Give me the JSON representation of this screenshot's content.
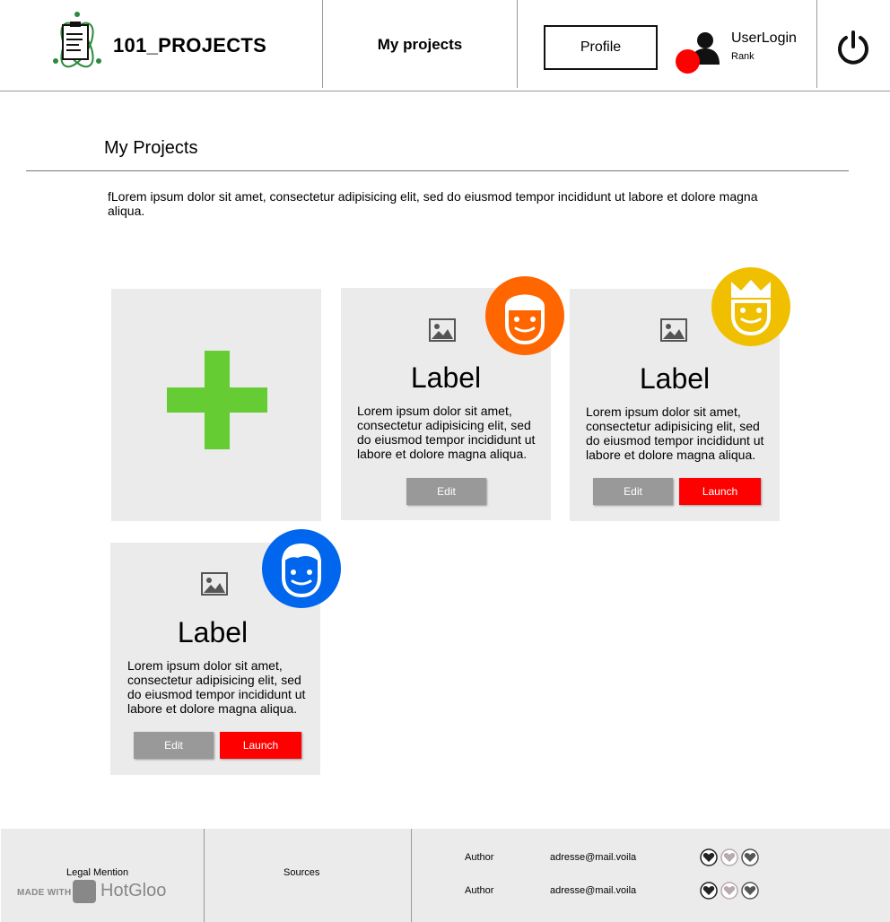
{
  "header": {
    "logo_text": "101_PROJECTS",
    "nav_my_projects": "My projects",
    "profile_button": "Profile",
    "user_login": "UserLogin",
    "user_rank": "Rank"
  },
  "section": {
    "title": "My Projects",
    "intro": "fLorem ipsum dolor sit amet, consectetur adipisicing elit, sed do eiusmod tempor incididunt ut labore et dolore magna aliqua."
  },
  "cards": [
    {
      "label": "Label",
      "description": "Lorem ipsum dolor sit amet, consectetur adipisicing elit, sed do eiusmod tempor incididunt ut labore et dolore magna aliqua.",
      "edit_label": "Edit",
      "badge_color": "#ff6600"
    },
    {
      "label": "Label",
      "description": "Lorem ipsum dolor sit amet, consectetur adipisicing elit, sed do eiusmod tempor incididunt ut labore et dolore magna aliqua.",
      "edit_label": "Edit",
      "launch_label": "Launch",
      "badge_color": "#f0c000"
    },
    {
      "label": "Label",
      "description": "Lorem ipsum dolor sit amet, consectetur adipisicing elit, sed do eiusmod tempor incididunt ut labore et dolore magna aliqua.",
      "edit_label": "Edit",
      "launch_label": "Launch",
      "badge_color": "#0066ee"
    }
  ],
  "footer": {
    "legal_mention": "Legal Mention",
    "made_with": "MADE WITH",
    "hotgloo": "HotGloo",
    "sources": "Sources",
    "authors": [
      {
        "name": "Author",
        "email": "adresse@mail.voila"
      },
      {
        "name": "Author",
        "email": "adresse@mail.voila"
      }
    ]
  },
  "colors": {
    "accent_red": "#ff0000",
    "add_green": "#66cc33",
    "card_bg": "#ebebeb",
    "button_gray": "#999999"
  }
}
